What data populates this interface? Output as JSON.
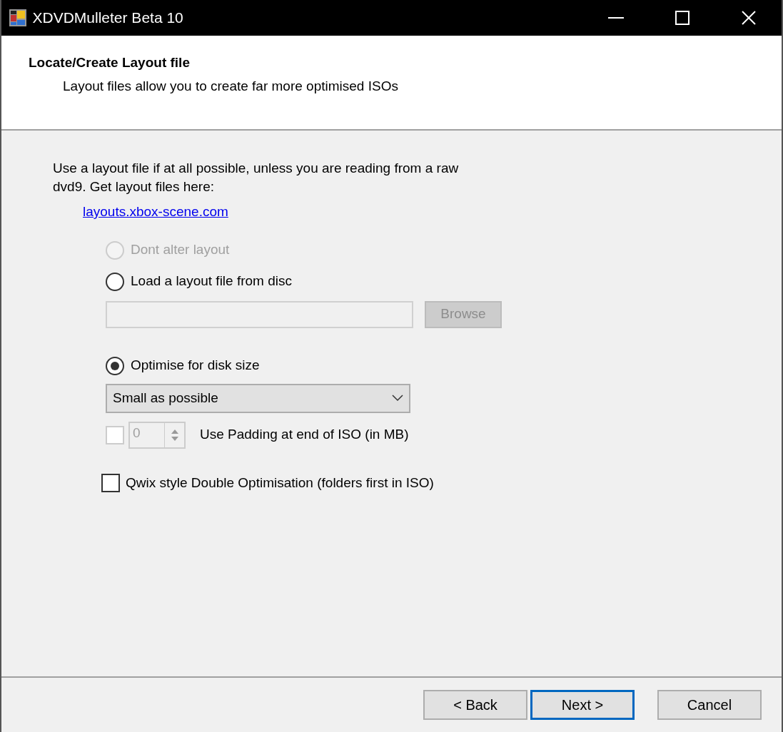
{
  "window": {
    "title": "XDVDMulleter Beta 10"
  },
  "header": {
    "title": "Locate/Create Layout file",
    "subtitle": "Layout files allow you to create far more optimised ISOs"
  },
  "intro": "Use a layout file if at all possible, unless you are reading from a raw dvd9. Get layout files here:",
  "link": "layouts.xbox-scene.com",
  "radios": [
    {
      "label": "Dont alter layout",
      "selected": false,
      "disabled": true
    },
    {
      "label": "Load a layout file from disc",
      "selected": false,
      "disabled": false
    },
    {
      "label": "Optimise for disk size",
      "selected": true,
      "disabled": false
    }
  ],
  "file_field": {
    "disabled": true
  },
  "browse_button": {
    "label": "Browse",
    "disabled": true
  },
  "size_dropdown": {
    "value": "Small as possible"
  },
  "padding": {
    "checked": false,
    "disabled": true,
    "spinner_value": "0",
    "label": "Use Padding at end of ISO (in MB)"
  },
  "qwix": {
    "checked": false,
    "label": "Qwix style Double Optimisation (folders first in ISO)"
  },
  "buttons": [
    {
      "label": "< Back",
      "focused": false
    },
    {
      "label": "Next >",
      "focused": true
    },
    {
      "label": "Cancel",
      "focused": false
    }
  ]
}
